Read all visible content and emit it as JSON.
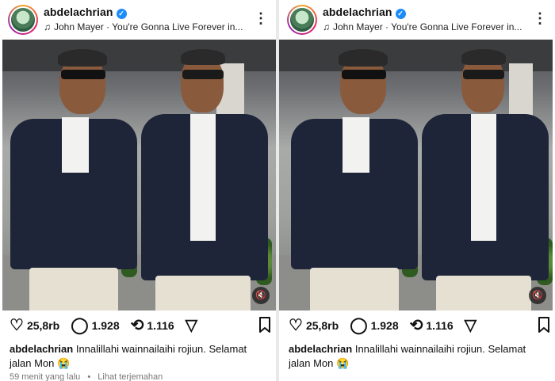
{
  "post": {
    "username": "abdelachrian",
    "verified_badge": "✓",
    "music_icon": "music-note-icon",
    "music": "John Mayer · You're Gonna Live Forever in...",
    "more_icon": "⋮",
    "likes": "25,8rb",
    "comments": "1.928",
    "reposts": "1.116",
    "caption_text": "Innalillahi wainnailaihi rojiun. Selamat jalan Mon 😭",
    "time": "59 menit yang lalu",
    "separator": "•",
    "translate": "Lihat terjemahan",
    "mute_icon": "🔇"
  },
  "colors": {
    "verified": "#1d8cf8",
    "jacket": "#1e2538"
  }
}
